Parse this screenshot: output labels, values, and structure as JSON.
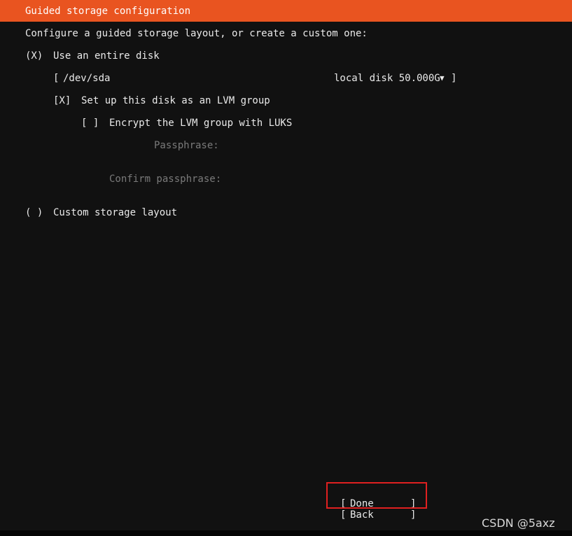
{
  "header": {
    "title": "Guided storage configuration"
  },
  "intro": "Configure a guided storage layout, or create a custom one:",
  "use_entire_disk": {
    "marker": "(X)",
    "label": "Use an entire disk"
  },
  "disk_select": {
    "open_bracket": "[",
    "device": "/dev/sda",
    "description": "local disk 50.000G",
    "caret": "▼",
    "close_bracket": "]"
  },
  "lvm": {
    "marker": "[X]",
    "label": "Set up this disk as an LVM group"
  },
  "luks": {
    "marker": "[ ]",
    "label": "Encrypt the LVM group with LUKS"
  },
  "passphrase": {
    "label": "Passphrase:",
    "value": ""
  },
  "confirm_passphrase": {
    "label": "Confirm passphrase:",
    "value": ""
  },
  "custom_layout": {
    "marker": "( )",
    "label": "Custom storage layout"
  },
  "buttons": {
    "done": {
      "open": "[",
      "label": "Done",
      "close": "]"
    },
    "back": {
      "open": "[",
      "label": "Back",
      "close": "]"
    }
  },
  "annotation": {
    "highlight_color": "#e02020"
  },
  "watermark": "CSDN @5axz",
  "colors": {
    "accent": "#e95420",
    "background": "#111111",
    "text": "#eaeaea",
    "dim_text": "#7a7a7a"
  }
}
